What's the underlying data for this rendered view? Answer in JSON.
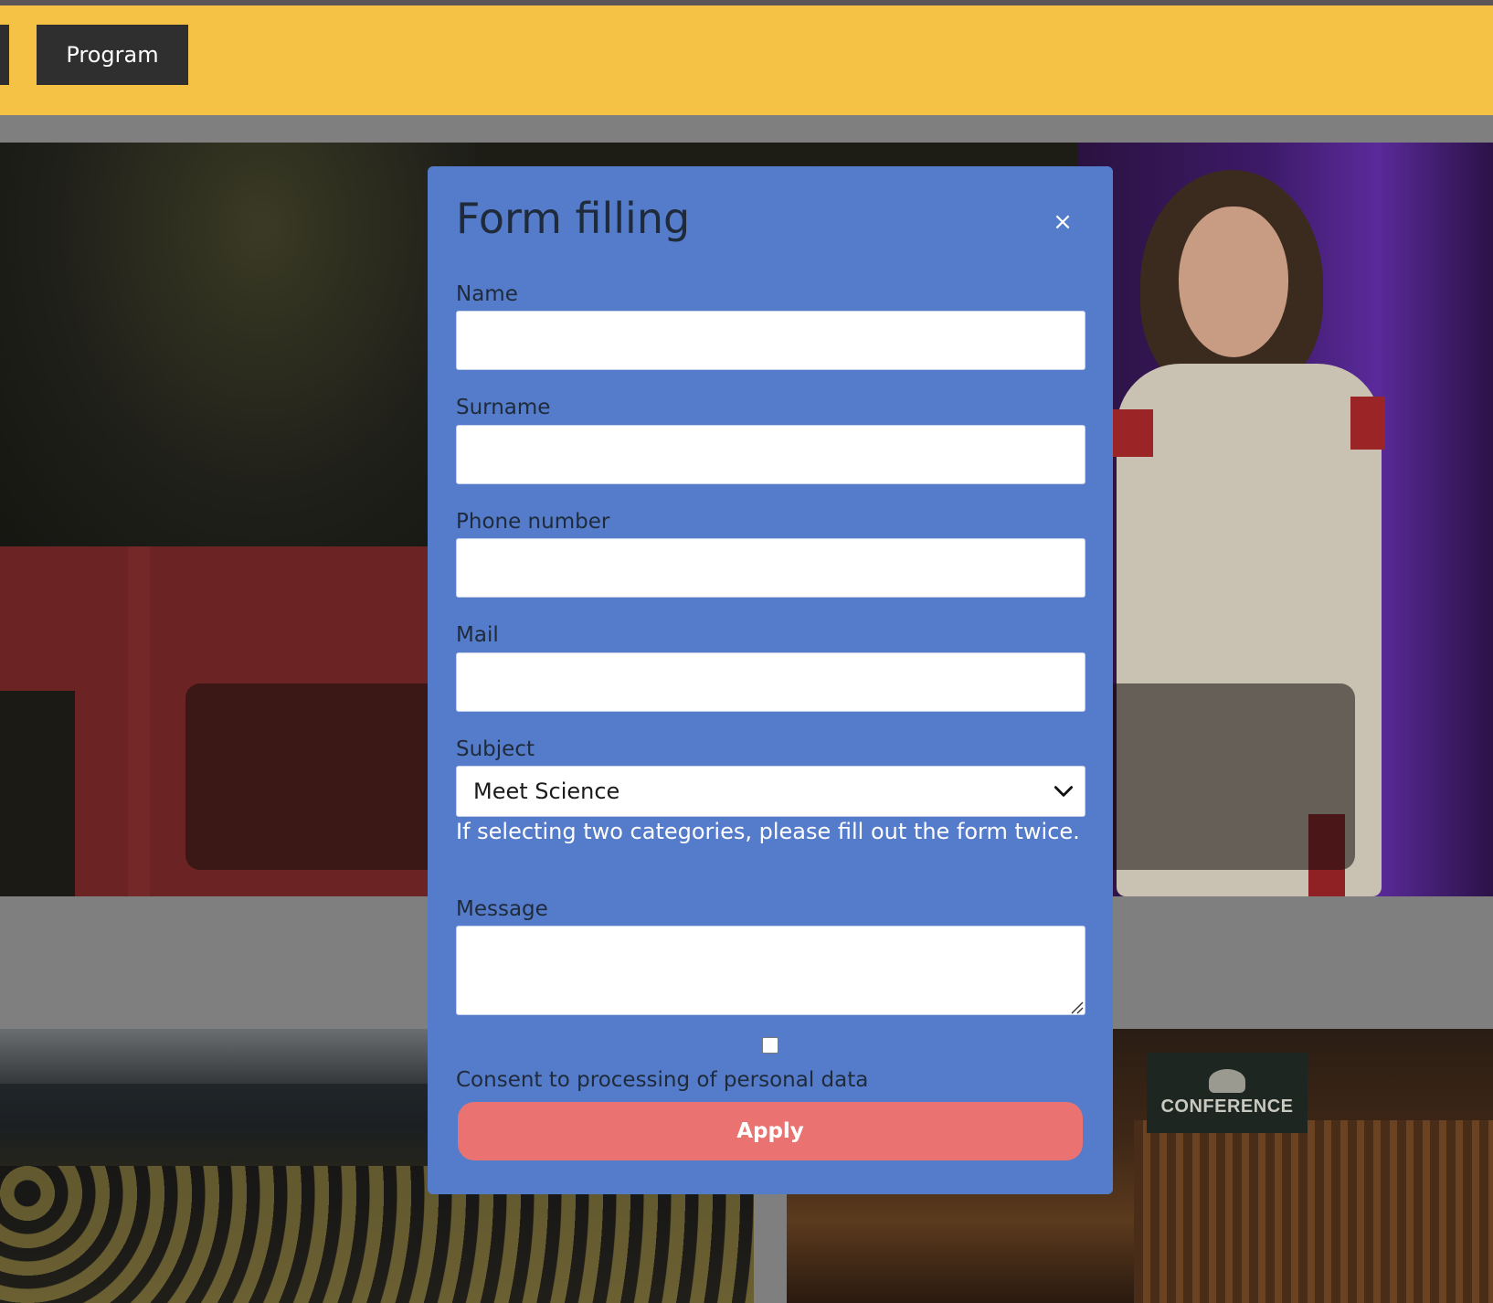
{
  "header": {
    "nav_program_label": "Program"
  },
  "background": {
    "conference_sign_text": "CONFERENCE"
  },
  "modal": {
    "title": "Form filling",
    "close_glyph": "×",
    "fields": {
      "name": {
        "label": "Name",
        "value": ""
      },
      "surname": {
        "label": "Surname",
        "value": ""
      },
      "phone": {
        "label": "Phone number",
        "value": ""
      },
      "mail": {
        "label": "Mail",
        "value": ""
      }
    },
    "subject": {
      "label": "Subject",
      "selected": "Meet Science",
      "hint": "If selecting two categories, please fill out the form twice."
    },
    "message": {
      "label": "Message",
      "value": ""
    },
    "consent": {
      "label": "Consent to processing of personal data",
      "checked": false
    },
    "apply_label": "Apply"
  },
  "icons": {
    "close": "close-icon",
    "dropdown": "chevron-down-icon",
    "resize": "resize-handle-icon"
  },
  "colors": {
    "header": "#f5c245",
    "modal": "#557cca",
    "apply_button": "#ea7371",
    "nav_button": "#2f2f30"
  }
}
